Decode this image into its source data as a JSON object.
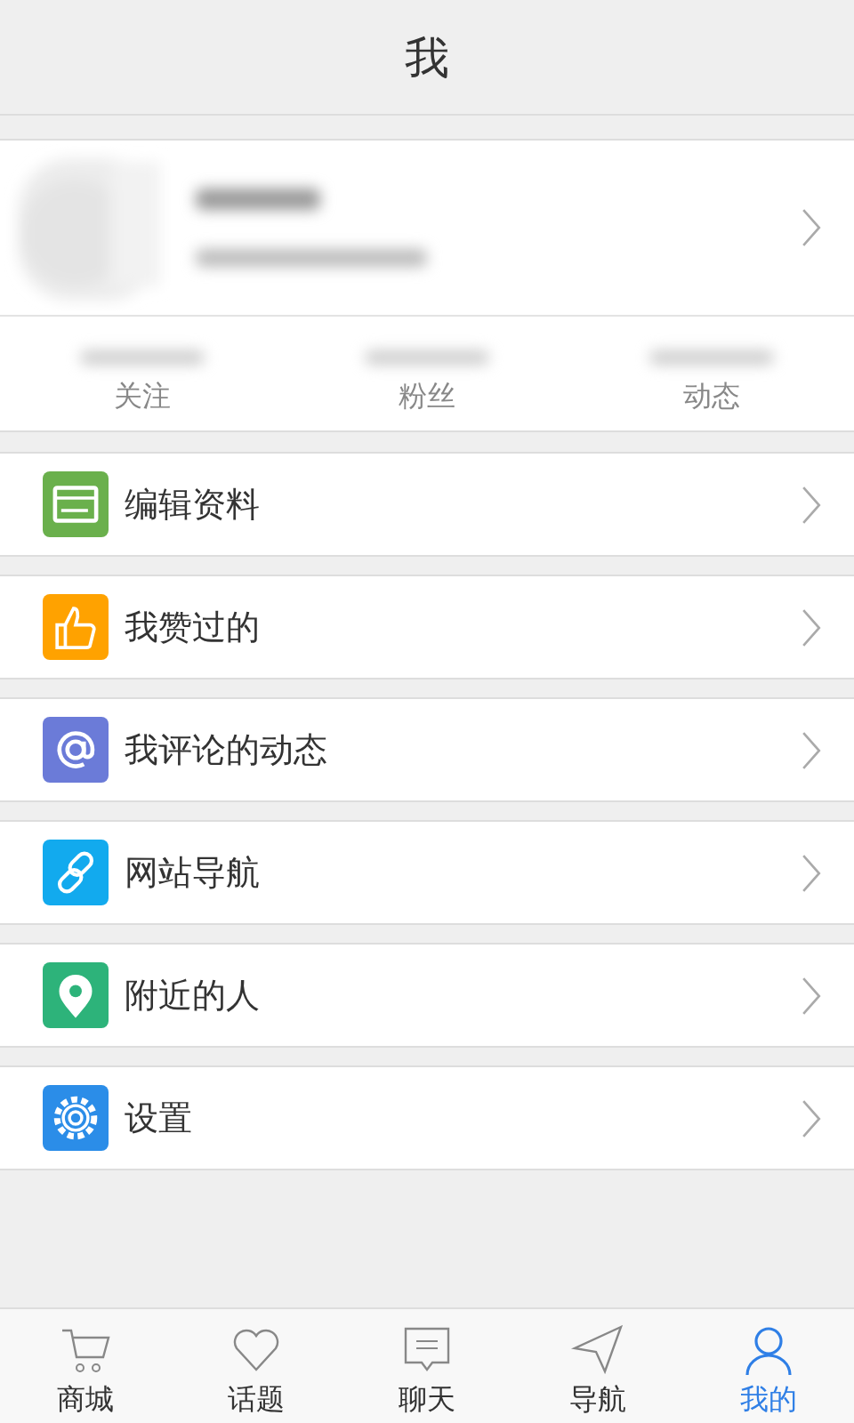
{
  "header": {
    "title": "我"
  },
  "stats": [
    {
      "label": "关注"
    },
    {
      "label": "粉丝"
    },
    {
      "label": "动态"
    }
  ],
  "menu": [
    {
      "label": "编辑资料",
      "kind": "card",
      "color": "#6ab04c"
    },
    {
      "label": "我赞过的",
      "kind": "thumb",
      "color": "#ffa200"
    },
    {
      "label": "我评论的动态",
      "kind": "at",
      "color": "#6b7bd8"
    },
    {
      "label": "网站导航",
      "kind": "link",
      "color": "#12aaee"
    },
    {
      "label": "附近的人",
      "kind": "pin",
      "color": "#2db37a"
    },
    {
      "label": "设置",
      "kind": "gear",
      "color": "#2b8de8"
    }
  ],
  "tabs": [
    {
      "label": "商城",
      "kind": "cart",
      "selected": false
    },
    {
      "label": "话题",
      "kind": "heart",
      "selected": false
    },
    {
      "label": "聊天",
      "kind": "chat",
      "selected": false
    },
    {
      "label": "导航",
      "kind": "send",
      "selected": false
    },
    {
      "label": "我的",
      "kind": "person",
      "selected": true
    }
  ]
}
